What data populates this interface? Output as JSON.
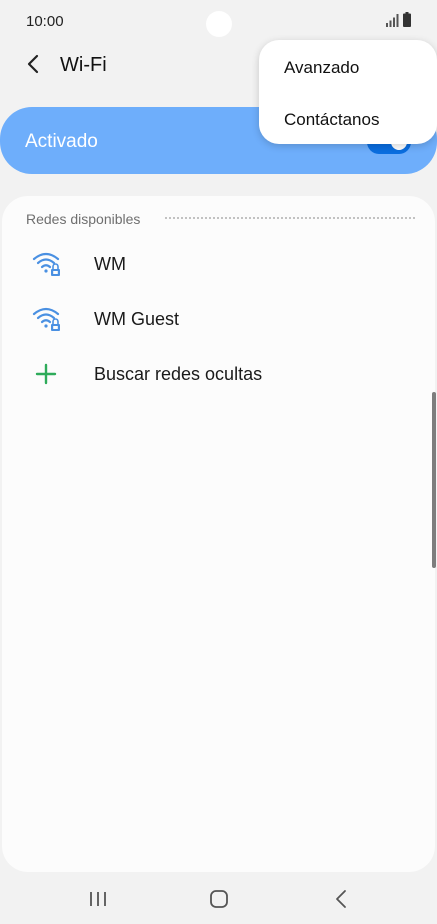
{
  "status_bar": {
    "time": "10:00",
    "icons": [
      "signal-icon",
      "battery-icon"
    ]
  },
  "header": {
    "back_icon": "back-arrow-icon",
    "title": "Wi-Fi"
  },
  "master_toggle": {
    "label": "Activado",
    "state": "on",
    "card_color": "#6eaefb",
    "switch_color": "#0a6ee0"
  },
  "networks": {
    "section_title": "Redes disponibles",
    "items": [
      {
        "label": "WM",
        "icon": "wifi-locked-icon"
      },
      {
        "label": "WM Guest",
        "icon": "wifi-locked-icon"
      },
      {
        "label": "Buscar redes ocultas",
        "icon": "plus-icon"
      }
    ]
  },
  "popup_menu": {
    "items": [
      "Avanzado",
      "Contáctanos"
    ]
  },
  "nav_bar": {
    "icons": [
      "recents-icon",
      "home-icon",
      "back-icon"
    ]
  },
  "colors": {
    "wifi_icon": "#4a90e2",
    "plus_icon": "#2eab5a"
  }
}
